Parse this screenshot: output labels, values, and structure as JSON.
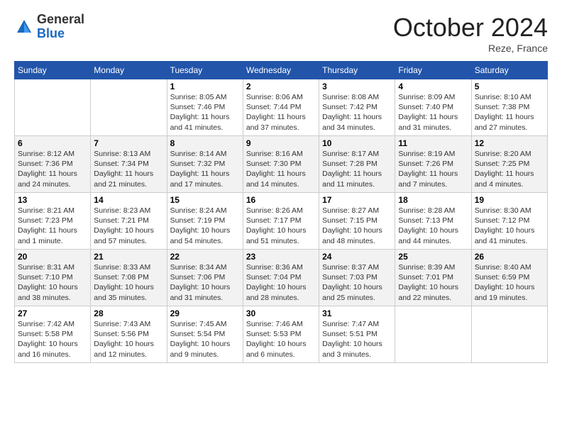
{
  "logo": {
    "general": "General",
    "blue": "Blue"
  },
  "header": {
    "month": "October 2024",
    "location": "Reze, France"
  },
  "days_of_week": [
    "Sunday",
    "Monday",
    "Tuesday",
    "Wednesday",
    "Thursday",
    "Friday",
    "Saturday"
  ],
  "weeks": [
    [
      {
        "day": "",
        "info": ""
      },
      {
        "day": "",
        "info": ""
      },
      {
        "day": "1",
        "info": "Sunrise: 8:05 AM\nSunset: 7:46 PM\nDaylight: 11 hours and 41 minutes."
      },
      {
        "day": "2",
        "info": "Sunrise: 8:06 AM\nSunset: 7:44 PM\nDaylight: 11 hours and 37 minutes."
      },
      {
        "day": "3",
        "info": "Sunrise: 8:08 AM\nSunset: 7:42 PM\nDaylight: 11 hours and 34 minutes."
      },
      {
        "day": "4",
        "info": "Sunrise: 8:09 AM\nSunset: 7:40 PM\nDaylight: 11 hours and 31 minutes."
      },
      {
        "day": "5",
        "info": "Sunrise: 8:10 AM\nSunset: 7:38 PM\nDaylight: 11 hours and 27 minutes."
      }
    ],
    [
      {
        "day": "6",
        "info": "Sunrise: 8:12 AM\nSunset: 7:36 PM\nDaylight: 11 hours and 24 minutes."
      },
      {
        "day": "7",
        "info": "Sunrise: 8:13 AM\nSunset: 7:34 PM\nDaylight: 11 hours and 21 minutes."
      },
      {
        "day": "8",
        "info": "Sunrise: 8:14 AM\nSunset: 7:32 PM\nDaylight: 11 hours and 17 minutes."
      },
      {
        "day": "9",
        "info": "Sunrise: 8:16 AM\nSunset: 7:30 PM\nDaylight: 11 hours and 14 minutes."
      },
      {
        "day": "10",
        "info": "Sunrise: 8:17 AM\nSunset: 7:28 PM\nDaylight: 11 hours and 11 minutes."
      },
      {
        "day": "11",
        "info": "Sunrise: 8:19 AM\nSunset: 7:26 PM\nDaylight: 11 hours and 7 minutes."
      },
      {
        "day": "12",
        "info": "Sunrise: 8:20 AM\nSunset: 7:25 PM\nDaylight: 11 hours and 4 minutes."
      }
    ],
    [
      {
        "day": "13",
        "info": "Sunrise: 8:21 AM\nSunset: 7:23 PM\nDaylight: 11 hours and 1 minute."
      },
      {
        "day": "14",
        "info": "Sunrise: 8:23 AM\nSunset: 7:21 PM\nDaylight: 10 hours and 57 minutes."
      },
      {
        "day": "15",
        "info": "Sunrise: 8:24 AM\nSunset: 7:19 PM\nDaylight: 10 hours and 54 minutes."
      },
      {
        "day": "16",
        "info": "Sunrise: 8:26 AM\nSunset: 7:17 PM\nDaylight: 10 hours and 51 minutes."
      },
      {
        "day": "17",
        "info": "Sunrise: 8:27 AM\nSunset: 7:15 PM\nDaylight: 10 hours and 48 minutes."
      },
      {
        "day": "18",
        "info": "Sunrise: 8:28 AM\nSunset: 7:13 PM\nDaylight: 10 hours and 44 minutes."
      },
      {
        "day": "19",
        "info": "Sunrise: 8:30 AM\nSunset: 7:12 PM\nDaylight: 10 hours and 41 minutes."
      }
    ],
    [
      {
        "day": "20",
        "info": "Sunrise: 8:31 AM\nSunset: 7:10 PM\nDaylight: 10 hours and 38 minutes."
      },
      {
        "day": "21",
        "info": "Sunrise: 8:33 AM\nSunset: 7:08 PM\nDaylight: 10 hours and 35 minutes."
      },
      {
        "day": "22",
        "info": "Sunrise: 8:34 AM\nSunset: 7:06 PM\nDaylight: 10 hours and 31 minutes."
      },
      {
        "day": "23",
        "info": "Sunrise: 8:36 AM\nSunset: 7:04 PM\nDaylight: 10 hours and 28 minutes."
      },
      {
        "day": "24",
        "info": "Sunrise: 8:37 AM\nSunset: 7:03 PM\nDaylight: 10 hours and 25 minutes."
      },
      {
        "day": "25",
        "info": "Sunrise: 8:39 AM\nSunset: 7:01 PM\nDaylight: 10 hours and 22 minutes."
      },
      {
        "day": "26",
        "info": "Sunrise: 8:40 AM\nSunset: 6:59 PM\nDaylight: 10 hours and 19 minutes."
      }
    ],
    [
      {
        "day": "27",
        "info": "Sunrise: 7:42 AM\nSunset: 5:58 PM\nDaylight: 10 hours and 16 minutes."
      },
      {
        "day": "28",
        "info": "Sunrise: 7:43 AM\nSunset: 5:56 PM\nDaylight: 10 hours and 12 minutes."
      },
      {
        "day": "29",
        "info": "Sunrise: 7:45 AM\nSunset: 5:54 PM\nDaylight: 10 hours and 9 minutes."
      },
      {
        "day": "30",
        "info": "Sunrise: 7:46 AM\nSunset: 5:53 PM\nDaylight: 10 hours and 6 minutes."
      },
      {
        "day": "31",
        "info": "Sunrise: 7:47 AM\nSunset: 5:51 PM\nDaylight: 10 hours and 3 minutes."
      },
      {
        "day": "",
        "info": ""
      },
      {
        "day": "",
        "info": ""
      }
    ]
  ]
}
